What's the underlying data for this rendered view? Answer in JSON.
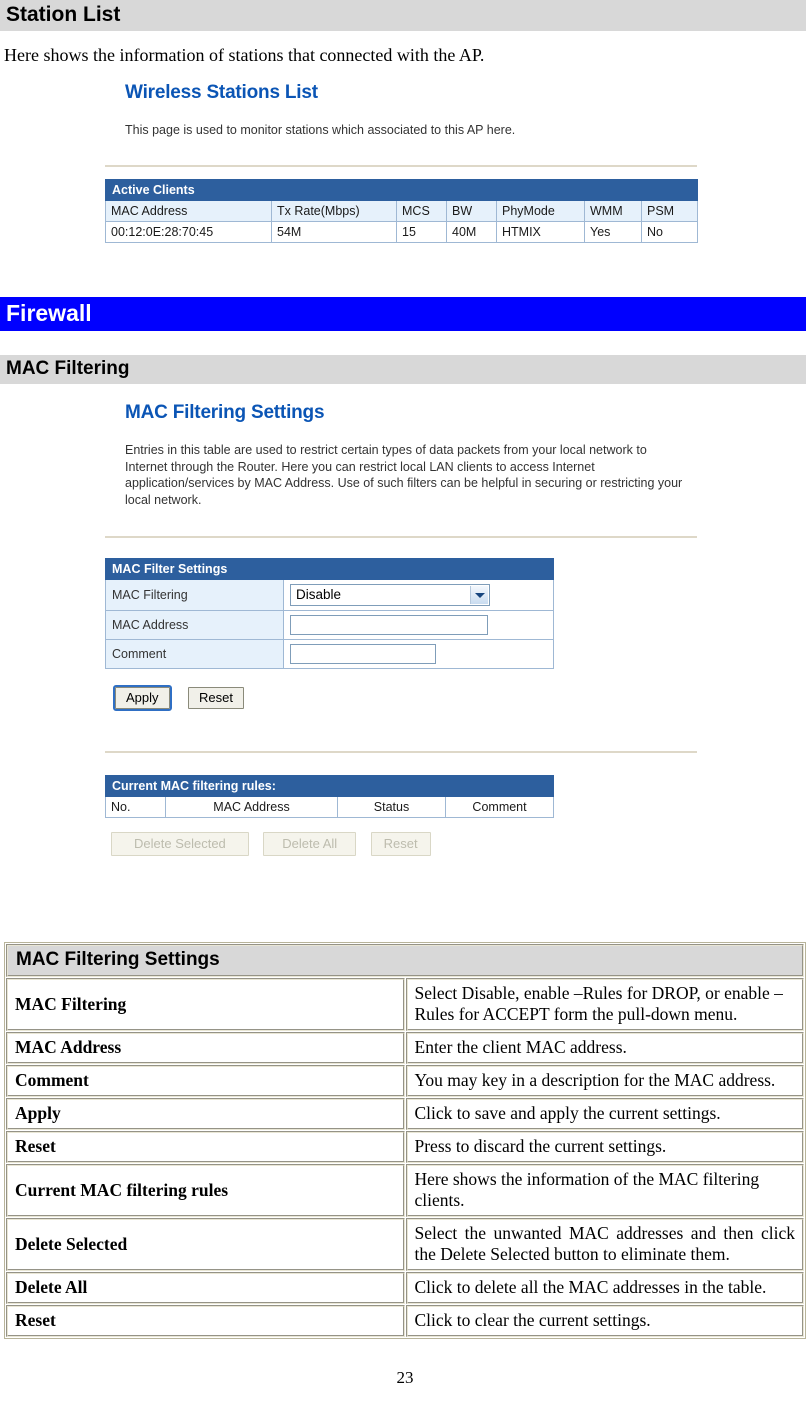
{
  "page": {
    "number": "23"
  },
  "sections": {
    "station_list": {
      "heading": "Station List",
      "intro": "Here shows the information of stations that connected with the AP."
    },
    "firewall": {
      "heading": "Firewall"
    },
    "mac_filtering": {
      "heading": "MAC Filtering"
    }
  },
  "stations_screenshot": {
    "title": "Wireless Stations List",
    "description": "This page is used to monitor stations which associated to this AP here.",
    "table": {
      "band_title": "Active Clients",
      "columns": [
        "MAC Address",
        "Tx Rate(Mbps)",
        "MCS",
        "BW",
        "PhyMode",
        "WMM",
        "PSM"
      ],
      "rows": [
        [
          "00:12:0E:28:70:45",
          "54M",
          "15",
          "40M",
          "HTMIX",
          "Yes",
          "No"
        ]
      ]
    }
  },
  "macfilter_screenshot": {
    "title": "MAC Filtering Settings",
    "description": "Entries in this table are used to restrict certain types of data packets from your local network to Internet through the Router. Here you can restrict local LAN clients to access Internet application/services by MAC Address. Use of such filters can be helpful in securing or restricting your local network.",
    "settings_table": {
      "band_title": "MAC Filter Settings",
      "rows": [
        {
          "label": "MAC Filtering",
          "control": "select",
          "value": "Disable"
        },
        {
          "label": "MAC Address",
          "control": "text",
          "value": ""
        },
        {
          "label": "Comment",
          "control": "text",
          "value": ""
        }
      ]
    },
    "form_buttons": {
      "apply": "Apply",
      "reset": "Reset"
    },
    "rules_table": {
      "band_title": "Current MAC filtering rules:",
      "columns": [
        "No.",
        "MAC Address",
        "Status",
        "Comment"
      ],
      "rows": []
    },
    "rules_buttons": {
      "delete_selected": "Delete Selected",
      "delete_all": "Delete All",
      "reset": "Reset"
    }
  },
  "description_table": {
    "header": "MAC Filtering Settings",
    "rows": [
      {
        "key": "MAC Filtering",
        "value": "Select Disable, enable –Rules for DROP, or enable –Rules for ACCEPT form the pull-down menu."
      },
      {
        "key": "MAC Address",
        "value": "Enter the client MAC address."
      },
      {
        "key": "Comment",
        "value": "You may key in a description for the MAC address."
      },
      {
        "key": "Apply",
        "value": "Click to save and apply the current settings."
      },
      {
        "key": "Reset",
        "value": "Press to discard the current settings."
      },
      {
        "key": "Current MAC filtering rules",
        "value": "Here shows the information of the MAC filtering clients."
      },
      {
        "key": "Delete Selected",
        "value": "Select the unwanted MAC addresses and then click the Delete Selected button to eliminate them."
      },
      {
        "key": "Delete All",
        "value": "Click to delete all the MAC addresses in the table."
      },
      {
        "key": "Reset",
        "value": "Click to clear the current settings."
      }
    ]
  },
  "colors": {
    "section_gray": "#d8d8d8",
    "firewall_blue": "#0000ff",
    "router_band_blue": "#2d5f9e",
    "router_title_blue": "#0b55b5",
    "router_cell_blue": "#e6f1fb"
  }
}
